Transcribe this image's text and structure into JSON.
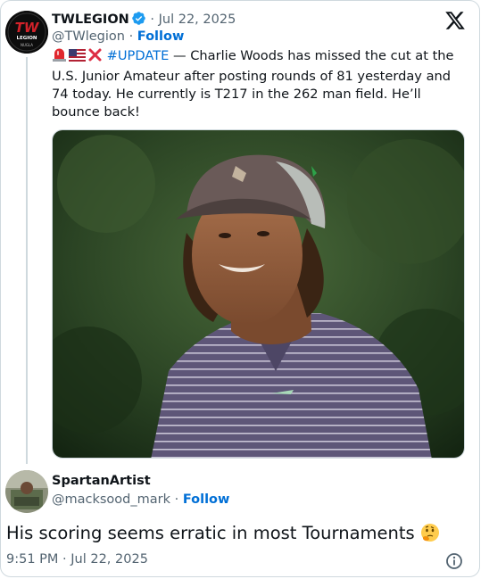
{
  "tweet": {
    "avatar_logo_top": "TW",
    "avatar_logo_mid": "LEGION",
    "avatar_logo_bottom": "NUGLA",
    "author_name": "TWLEGION",
    "separator": "·",
    "date": "Jul 22, 2025",
    "handle": "@TWlegion",
    "follow_label": "Follow",
    "hashtag": "#UPDATE",
    "body": " — Charlie Woods has missed the cut at the U.S. Junior Amateur after posting rounds of 81 yesterday and 74 today. He currently is T217 in the 262 man field. He’ll bounce back!",
    "emojis": [
      "rotating-light-emoji",
      "us-flag-emoji",
      "cross-mark-emoji"
    ],
    "photo": "Charlie Woods in a grey cap and striped purple polo, dark green background"
  },
  "reply": {
    "author_name": "SpartanArtist",
    "handle": "@macksood_mark",
    "separator": "·",
    "follow_label": "Follow",
    "text": "His scoring seems erratic in most Tournaments",
    "text_emoji": "thinking-face-emoji"
  },
  "footer": {
    "timestamp": "9:51 PM · Jul 22, 2025"
  },
  "colors": {
    "link": "#006fd6",
    "muted": "#536471",
    "border": "#cfd9de",
    "verified": "#1d9bf0"
  },
  "icons": [
    "x-logo-icon",
    "verified-badge-icon",
    "info-icon"
  ]
}
